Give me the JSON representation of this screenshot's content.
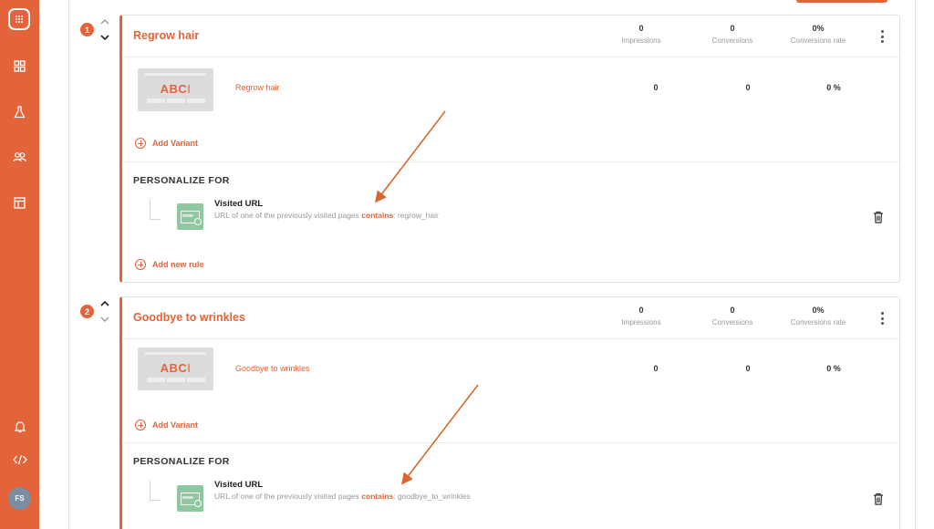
{
  "sidebar": {
    "icons": [
      "logo-icon",
      "dashboard-icon",
      "flask-icon",
      "users-icon",
      "layout-icon",
      "bell-icon",
      "code-icon"
    ],
    "avatar_initials": "FS"
  },
  "colors": {
    "accent": "#e3633a",
    "rule_icon": "#8fc7a0"
  },
  "metric_labels": {
    "impressions": "Impressions",
    "conversions": "Conversions",
    "rate": "Conversions rate"
  },
  "thumb_text": "ABC",
  "add_variant_label": "Add Variant",
  "add_rule_label": "Add new rule",
  "personalize_label": "PERSONALIZE FOR",
  "experiences": [
    {
      "number": "1",
      "title": "Regrow hair",
      "impressions": "0",
      "conversions": "0",
      "rate": "0%",
      "variant": {
        "name": "Regrow hair",
        "impressions": "0",
        "conversions": "0",
        "rate": "0 %"
      },
      "rule": {
        "title": "Visited URL",
        "desc_prefix": "URL of one of the previously visited pages",
        "operator": "contains",
        "value": ": regrow_hair"
      }
    },
    {
      "number": "2",
      "title": "Goodbye to wrinkles",
      "impressions": "0",
      "conversions": "0",
      "rate": "0%",
      "variant": {
        "name": "Goodbye to wrinkles",
        "impressions": "0",
        "conversions": "0",
        "rate": "0 %"
      },
      "rule": {
        "title": "Visited URL",
        "desc_prefix": "URL of one of the previously visited pages",
        "operator": "contains",
        "value": ": goodbye_to_wrinkles"
      }
    }
  ]
}
